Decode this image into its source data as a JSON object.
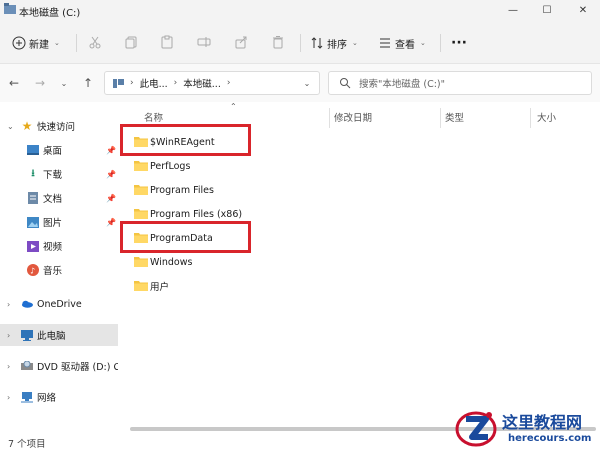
{
  "window": {
    "title": "本地磁盘 (C:)",
    "buttons": {
      "minimize": "—",
      "maximize": "☐",
      "close": "✕"
    }
  },
  "toolbar": {
    "new_label": "新建",
    "sort_label": "排序",
    "view_label": "查看",
    "more_label": "···",
    "icons": [
      "cut-icon",
      "copy-icon",
      "paste-icon",
      "rename-icon",
      "share-icon",
      "delete-icon"
    ]
  },
  "address": {
    "crumbs": [
      "此电...",
      "本地磁...",
      ""
    ],
    "chevron": "›"
  },
  "search": {
    "placeholder": "搜索\"本地磁盘 (C:)\""
  },
  "sidebar": {
    "items": [
      {
        "label": "快速访问",
        "icon": "star-icon",
        "expander": "⌄",
        "pinned": false
      },
      {
        "label": "桌面",
        "icon": "desktop-icon",
        "pinned": true
      },
      {
        "label": "下载",
        "icon": "download-icon",
        "pinned": true
      },
      {
        "label": "文档",
        "icon": "documents-icon",
        "pinned": true
      },
      {
        "label": "图片",
        "icon": "pictures-icon",
        "pinned": true
      },
      {
        "label": "视频",
        "icon": "videos-icon",
        "pinned": false
      },
      {
        "label": "音乐",
        "icon": "music-icon",
        "pinned": false
      },
      {
        "label": "OneDrive",
        "icon": "onedrive-icon",
        "expander": "›"
      },
      {
        "label": "此电脑",
        "icon": "this-pc-icon",
        "expander": "›",
        "selected": true
      },
      {
        "label": "DVD 驱动器 (D:) CF",
        "icon": "dvd-drive-icon",
        "expander": "›"
      },
      {
        "label": "网络",
        "icon": "network-icon",
        "expander": "›"
      }
    ]
  },
  "columns": {
    "name": "名称",
    "modified": "修改日期",
    "type": "类型",
    "size": "大小"
  },
  "files": [
    {
      "name": "$WinREAgent",
      "highlighted": true
    },
    {
      "name": "PerfLogs"
    },
    {
      "name": "Program Files"
    },
    {
      "name": "Program Files (x86)"
    },
    {
      "name": "ProgramData",
      "highlighted": true
    },
    {
      "name": "Windows"
    },
    {
      "name": "用户"
    }
  ],
  "status": {
    "count": "7 个项目"
  },
  "watermark": {
    "cn": "这里教程网",
    "en": "herecours.com"
  },
  "colors": {
    "highlight": "#d9252b",
    "folder": "#f4c542",
    "accent": "#1a4a9c"
  }
}
